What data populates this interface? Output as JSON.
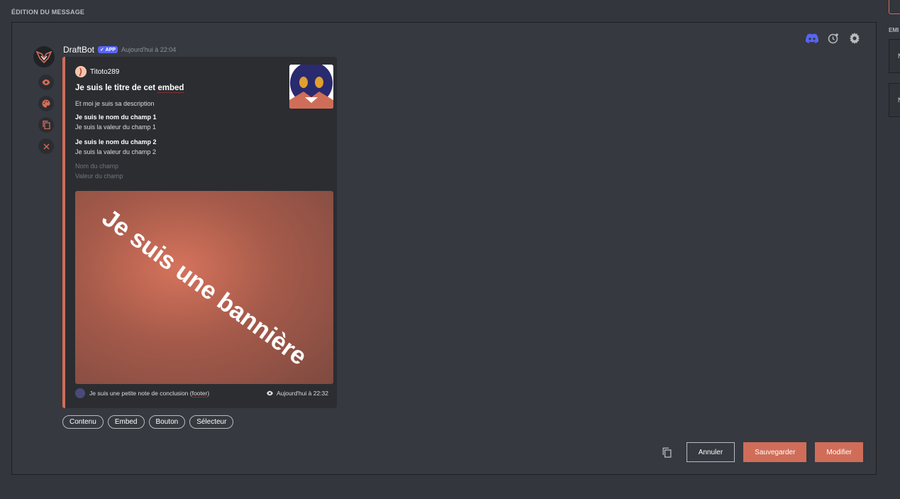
{
  "section_title": "ÉDITION DU MESSAGE",
  "message": {
    "bot_name": "DraftBot",
    "badge": "✓ APP",
    "timestamp": "Aujourd'hui à 22:04"
  },
  "embed": {
    "color": "#d06d59",
    "author_name": "Titoto289",
    "title_prefix": "Je suis le titre de cet ",
    "title_underlined": "embed",
    "description": "Et moi je suis sa description",
    "fields": [
      {
        "name": "Je suis le nom du champ 1",
        "value": "Je suis la valeur du champ 1"
      },
      {
        "name": "Je suis le nom du champ 2",
        "value": "Je suis la valeur du champ 2"
      }
    ],
    "placeholder_field": {
      "name": "Nom du champ",
      "value": "Valeur du champ"
    },
    "banner_text": "Je suis une bannière",
    "footer_prefix": "Je suis une petite note de conclusion (",
    "footer_underlined": "footer",
    "footer_suffix": ")",
    "footer_timestamp": "Aujourd'hui à 22:32"
  },
  "tabs": [
    "Contenu",
    "Embed",
    "Bouton",
    "Sélecteur"
  ],
  "buttons": {
    "cancel": "Annuler",
    "save": "Sauvegarder",
    "edit": "Modifier"
  },
  "right_panel": {
    "label": "EMI",
    "item1": "N",
    "item2": "N"
  },
  "icons": {
    "top": [
      "discord-icon",
      "clock-plus-icon",
      "gear-icon"
    ],
    "side": [
      "eye-icon",
      "palette-icon",
      "copy-icon",
      "close-icon"
    ]
  }
}
